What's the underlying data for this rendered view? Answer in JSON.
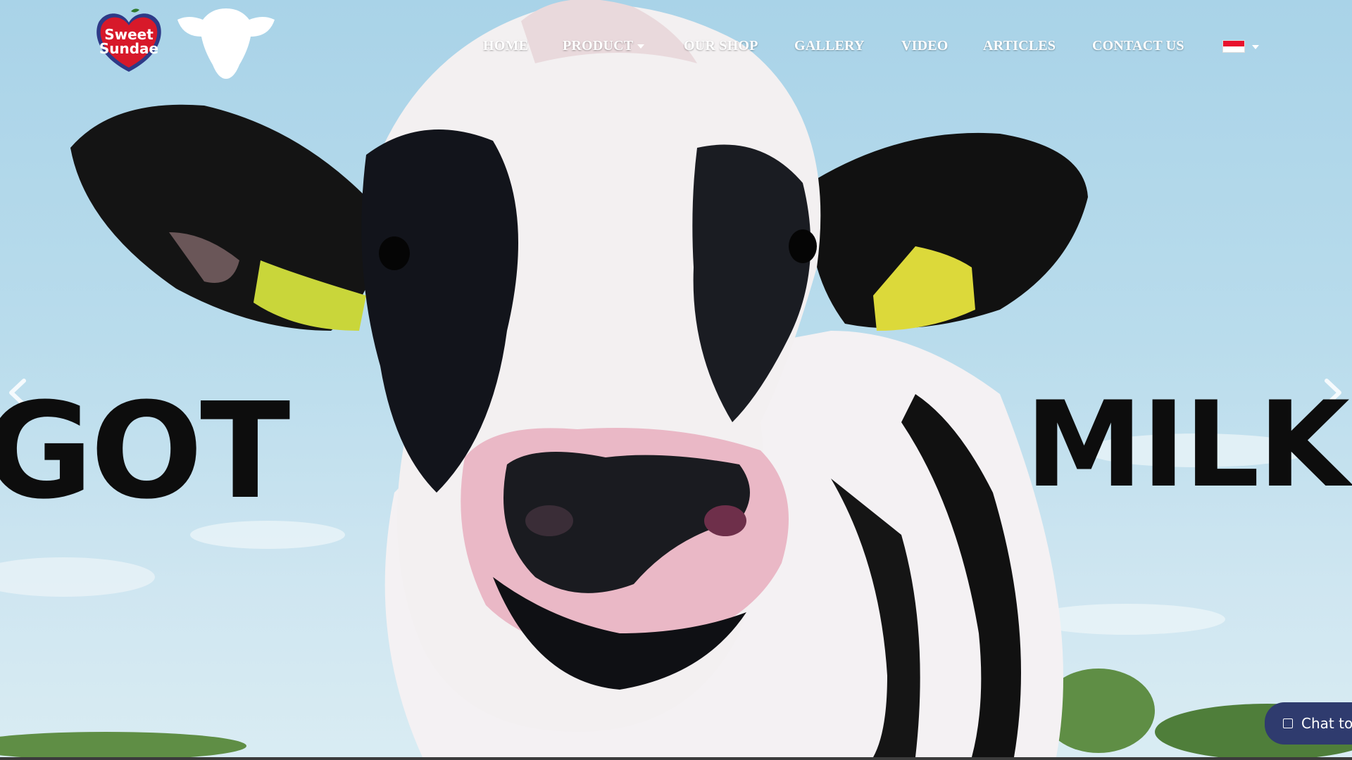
{
  "brand": {
    "logo_line1": "Sweet",
    "logo_line2": "Sundae"
  },
  "nav": {
    "items": [
      {
        "label": "HOME"
      },
      {
        "label": "PRODUCT",
        "has_dropdown": true
      },
      {
        "label": "OUR SHOP"
      },
      {
        "label": "GALLERY"
      },
      {
        "label": "VIDEO"
      },
      {
        "label": "ARTICLES"
      },
      {
        "label": "CONTACT US"
      }
    ],
    "language_flag": "indonesia-flag-icon"
  },
  "hero": {
    "word_left": "GOT",
    "word_right": "MILK",
    "prev_icon": "chevron-left-icon",
    "next_icon": "chevron-right-icon"
  },
  "chat": {
    "label": "Chat to",
    "icon": "chat-icon"
  },
  "colors": {
    "sky": "#b9dcec",
    "nav_text": "#ffffff",
    "logo_red": "#d7192a",
    "logo_blue": "#2e3a87",
    "chat_bg": "#2f3b6e",
    "tag_yellow": "#d6dc3a"
  }
}
